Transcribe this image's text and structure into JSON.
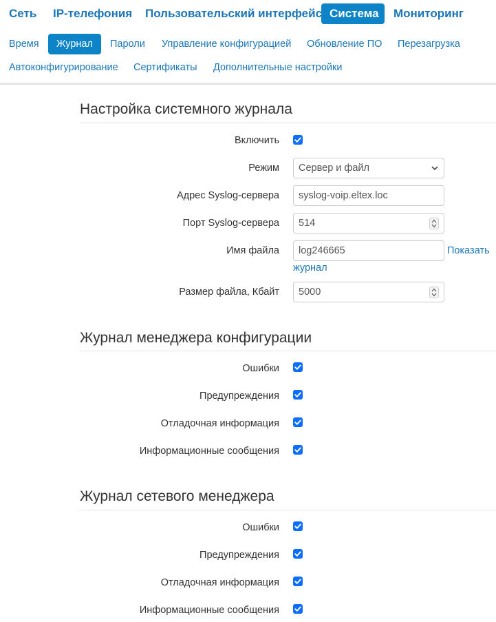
{
  "top_nav": [
    {
      "label": "Сеть",
      "active": false
    },
    {
      "label": "IP-телефония",
      "active": false
    },
    {
      "label": "Пользовательский интерфейс",
      "active": false
    },
    {
      "label": "Система",
      "active": true
    },
    {
      "label": "Мониторинг",
      "active": false
    }
  ],
  "sub_nav": [
    {
      "label": "Время",
      "active": false
    },
    {
      "label": "Журнал",
      "active": true
    },
    {
      "label": "Пароли",
      "active": false
    },
    {
      "label": "Управление конфигурацией",
      "active": false
    },
    {
      "label": "Обновление ПО",
      "active": false
    },
    {
      "label": "Перезагрузка",
      "active": false
    },
    {
      "label": "Автоконфигурирование",
      "active": false
    },
    {
      "label": "Сертификаты",
      "active": false
    },
    {
      "label": "Дополнительные настройки",
      "active": false
    }
  ],
  "syslog": {
    "title": "Настройка системного журнала",
    "enable_label": "Включить",
    "enable_checked": true,
    "mode_label": "Режим",
    "mode_value": "Сервер и файл",
    "server_label": "Адрес Syslog-сервера",
    "server_value": "syslog-voip.eltex.loc",
    "port_label": "Порт Syslog-сервера",
    "port_value": "514",
    "filename_label": "Имя файла",
    "filename_value": "log246665",
    "show_log_link_line1": "Показать",
    "show_log_link_line2": "журнал",
    "filesize_label": "Размер файла, Кбайт",
    "filesize_value": "5000"
  },
  "config_manager_log": {
    "title": "Журнал менеджера конфигурации",
    "items": [
      {
        "label": "Ошибки",
        "checked": true
      },
      {
        "label": "Предупреждения",
        "checked": true
      },
      {
        "label": "Отладочная информация",
        "checked": true
      },
      {
        "label": "Информационные сообщения",
        "checked": true
      }
    ]
  },
  "network_manager_log": {
    "title": "Журнал сетевого менеджера",
    "items": [
      {
        "label": "Ошибки",
        "checked": true
      },
      {
        "label": "Предупреждения",
        "checked": true
      },
      {
        "label": "Отладочная информация",
        "checked": true
      },
      {
        "label": "Информационные сообщения",
        "checked": true
      }
    ]
  },
  "colors": {
    "accent": "#0d84c8",
    "link": "#1a76b9",
    "checkbox": "#0d6efd"
  }
}
